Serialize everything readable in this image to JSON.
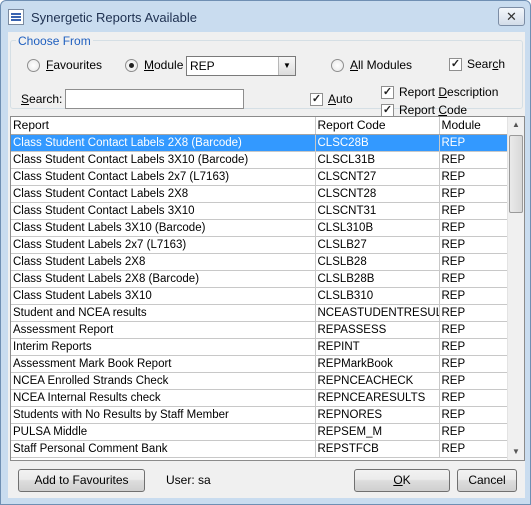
{
  "window": {
    "title": "Synergetic Reports Available",
    "close_glyph": "✕"
  },
  "choose_from": {
    "legend": "Choose From",
    "favourites": {
      "pre": "",
      "u": "F",
      "post": "avourites"
    },
    "module": {
      "pre": "",
      "u": "M",
      "post": "odule"
    },
    "module_value": "REP",
    "all_modules": {
      "pre": "",
      "u": "A",
      "post": "ll Modules"
    },
    "search_check": {
      "pre": "Sear",
      "u": "c",
      "post": "h"
    },
    "search_label": {
      "pre": "",
      "u": "S",
      "post": "earch:"
    },
    "search_value": "",
    "auto": {
      "pre": "",
      "u": "A",
      "post": "uto"
    },
    "report_description": {
      "pre": "Report ",
      "u": "D",
      "post": "escription"
    },
    "report_code": {
      "pre": "Report ",
      "u": "C",
      "post": "ode"
    },
    "selected_mode": "module",
    "checks": {
      "search": true,
      "auto": true,
      "report_description": true,
      "report_code": true
    }
  },
  "table": {
    "columns": [
      "Report",
      "Report Code",
      "Module"
    ],
    "rows": [
      [
        "Class Student Contact Labels 2X8 (Barcode)",
        "CLSC28B",
        "REP"
      ],
      [
        "Class Student Contact Labels 3X10 (Barcode)",
        "CLSCL31B",
        "REP"
      ],
      [
        "Class Student Contact Labels 2x7 (L7163)",
        "CLSCNT27",
        "REP"
      ],
      [
        "Class Student Contact Labels 2X8",
        "CLSCNT28",
        "REP"
      ],
      [
        "Class Student Contact Labels 3X10",
        "CLSCNT31",
        "REP"
      ],
      [
        "Class Student Labels 3X10 (Barcode)",
        "CLSL310B",
        "REP"
      ],
      [
        "Class Student Labels 2x7 (L7163)",
        "CLSLB27",
        "REP"
      ],
      [
        "Class Student Labels 2X8",
        "CLSLB28",
        "REP"
      ],
      [
        "Class Student Labels 2X8 (Barcode)",
        "CLSLB28B",
        "REP"
      ],
      [
        "Class Student Labels 3X10",
        "CLSLB310",
        "REP"
      ],
      [
        "Student and NCEA results",
        "NCEASTUDENTRESULTS",
        "REP"
      ],
      [
        "Assessment Report",
        "REPASSESS",
        "REP"
      ],
      [
        "Interim Reports",
        "REPINT",
        "REP"
      ],
      [
        "Assessment Mark Book Report",
        "REPMarkBook",
        "REP"
      ],
      [
        "NCEA Enrolled Strands Check",
        "REPNCEACHECK",
        "REP"
      ],
      [
        "NCEA Internal Results check",
        "REPNCEARESULTS",
        "REP"
      ],
      [
        "Students with No Results by Staff Member",
        "REPNORES",
        "REP"
      ],
      [
        "PULSA Middle",
        "REPSEM_M",
        "REP"
      ],
      [
        "Staff Personal Comment Bank",
        "REPSTFCB",
        "REP"
      ]
    ],
    "selected_row": 0
  },
  "footer": {
    "add_favourites": "Add to Favourites",
    "user_label": "User: sa",
    "ok": {
      "pre": "",
      "u": "O",
      "post": "K"
    },
    "cancel": "Cancel"
  },
  "colors": {
    "selection": "#3399ff",
    "legend": "#1f5fbf",
    "frame": "#c9dcef"
  },
  "icons": [
    "app-icon",
    "close-icon",
    "chevron-down-icon",
    "scroll-up-icon",
    "scroll-down-icon"
  ]
}
